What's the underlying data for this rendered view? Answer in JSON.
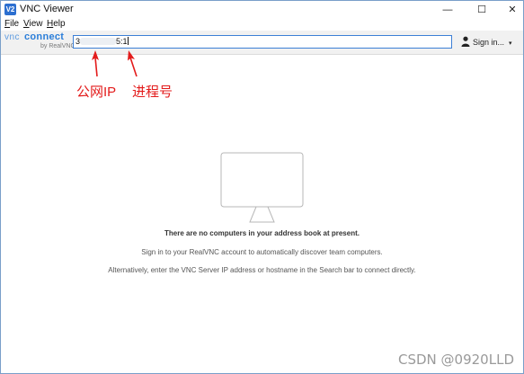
{
  "window": {
    "title": "VNC Viewer",
    "icon_label": "V2",
    "controls": {
      "minimize": "—",
      "maximize": "☐",
      "close": "✕"
    }
  },
  "menubar": {
    "items": [
      {
        "accel": "F",
        "rest": "ile"
      },
      {
        "accel": "V",
        "rest": "iew"
      },
      {
        "accel": "H",
        "rest": "elp"
      }
    ]
  },
  "toolbar": {
    "brand_vnc": "vnc",
    "brand_connect": "connect",
    "brand_by": "by RealVNC",
    "search_prefix": "3",
    "search_suffix": "5:1",
    "signin_label": "Sign in...",
    "signin_caret": "▾"
  },
  "annotations": {
    "public_ip": "公网IP",
    "process_number": "进程号"
  },
  "empty_state": {
    "heading": "There are no computers in your address book at present.",
    "line1": "Sign in to your RealVNC account to automatically discover team computers.",
    "line2": "Alternatively, enter the VNC Server IP address or hostname in the Search bar to connect directly."
  },
  "watermark": "CSDN @0920LLD",
  "colors": {
    "accent": "#3c7fd6",
    "brand": "#2b7ed9",
    "annotation": "#e31b1b",
    "toolbar_bg": "#f1f1f1"
  },
  "icons": {
    "app": "vnc-app-icon",
    "account": "person-icon",
    "empty_state": "monitor-icon"
  }
}
